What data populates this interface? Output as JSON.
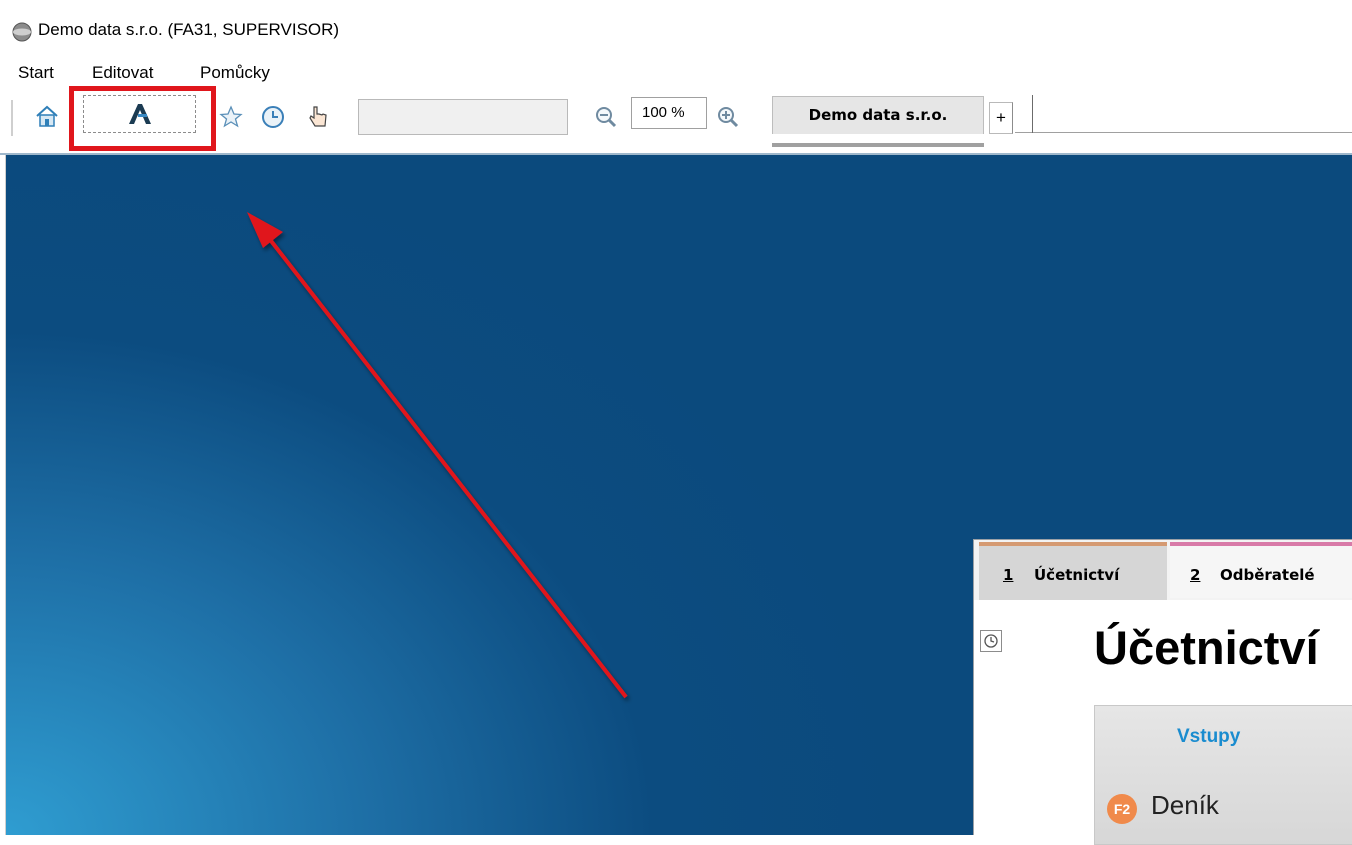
{
  "window": {
    "title": "Demo data s.r.o. (FA31, SUPERVISOR)"
  },
  "menu": {
    "items": [
      "Start",
      "Editovat",
      "Pomůcky"
    ]
  },
  "toolbar": {
    "icons": [
      "home-icon",
      "app-logo-icon",
      "star-icon",
      "clock-icon",
      "hand-pointer-icon",
      "zoom-out-icon",
      "zoom-in-icon"
    ],
    "search_value": "",
    "zoom_value": "100 %",
    "document_tab": "Demo data s.r.o.",
    "add_tab": "+"
  },
  "panel": {
    "tabs": [
      {
        "number": "1",
        "label": "Účetnictví"
      },
      {
        "number": "2",
        "label": "Odběratelé"
      }
    ],
    "heading": "Účetnictví",
    "card": {
      "header": "Vstupy",
      "item": {
        "key": "F2",
        "label": "Deník"
      }
    }
  },
  "colors": {
    "highlight": "#e0161c",
    "arrow": "#e0161c",
    "desktop_dark": "#0b4a7d",
    "desktop_light": "#2f9dd1",
    "card_header": "#1a8ccf",
    "badge": "#f08a4b"
  }
}
